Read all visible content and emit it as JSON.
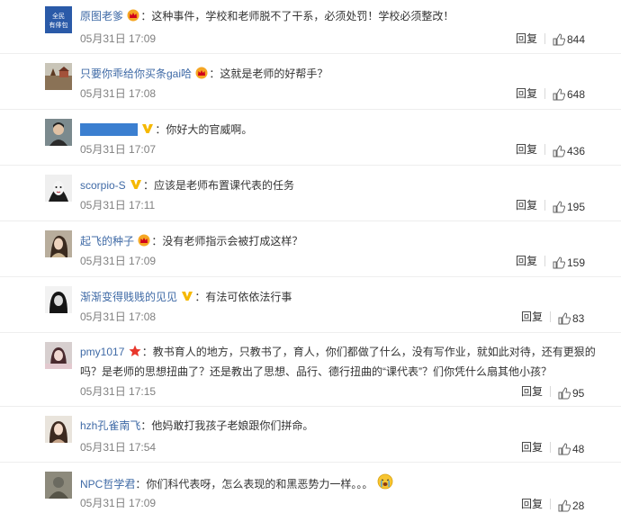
{
  "comments": [
    {
      "user": "原图老爹",
      "badge": "crown",
      "text": "这种事件，学校和老师脱不了干系，必须处罚！学校必须整改！",
      "time": "05月31日 17:09",
      "reply": "回复",
      "likes": "844"
    },
    {
      "user": "只要你乖给你买条gai哈",
      "badge": "crown",
      "text": "这就是老师的好帮手？",
      "time": "05月31日 17:08",
      "reply": "回复",
      "likes": "648"
    },
    {
      "user": "",
      "badge": "v",
      "text": "你好大的官威啊。",
      "time": "05月31日 17:07",
      "reply": "回复",
      "likes": "436"
    },
    {
      "user": "scorpio-S",
      "badge": "v",
      "text": "应该是老师布置课代表的任务",
      "time": "05月31日 17:11",
      "reply": "回复",
      "likes": "195"
    },
    {
      "user": "起飞的种子",
      "badge": "crown",
      "text": "没有老师指示会被打成这样？",
      "time": "05月31日 17:09",
      "reply": "回复",
      "likes": "159"
    },
    {
      "user": "渐渐变得贱贱的见见",
      "badge": "v",
      "text": "有法可依依法行事",
      "time": "05月31日 17:08",
      "reply": "回复",
      "likes": "83"
    },
    {
      "user": "pmy1017",
      "badge": "star",
      "text": "教书育人的地方，只教书了，育人，你们都做了什么，没有写作业，就如此对待，还有更狠的吗？是老师的思想扭曲了？还是教出了思想、品行、德行扭曲的“课代表”？们你凭什么扇其他小孩？",
      "time": "05月31日 17:15",
      "reply": "回复",
      "likes": "95"
    },
    {
      "user": "hzh孔雀南飞",
      "badge": "",
      "text": "他妈敢打我孩子老娘跟你们拼命。",
      "time": "05月31日 17:54",
      "reply": "回复",
      "likes": "48"
    },
    {
      "user": "NPC哲学君",
      "badge": "",
      "text": "你们科代表呀，怎么表现的和黑恶势力一样。。。",
      "emoji": "crying",
      "time": "05月31日 17:09",
      "reply": "回复",
      "likes": "28"
    }
  ],
  "avatar0_text": "全民\n有俳包",
  "colors": {
    "username": "#3f6aa6",
    "crown": "#e8a800",
    "v_badge": "#f5b800",
    "star": "#e8372c"
  }
}
